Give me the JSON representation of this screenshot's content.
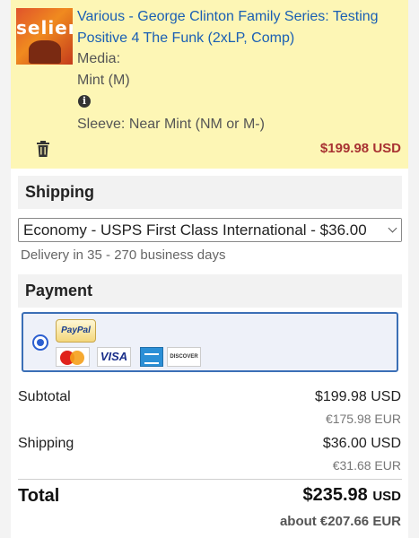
{
  "item": {
    "title": "Various - George Clinton Family Series: Testing Positive 4 The Funk (2xLP, Comp)",
    "media_label": "Media:",
    "media_value": "Mint (M)",
    "info_icon": "info-icon",
    "sleeve": "Sleeve: Near Mint (NM or M-)",
    "price": "$199.98",
    "price_currency": "USD",
    "thumb_text": "selier"
  },
  "shipping": {
    "heading": "Shipping",
    "selected_option": "Economy - USPS First Class International - $36.00",
    "delivery": "Delivery in 35 - 270 business days"
  },
  "payment": {
    "heading": "Payment",
    "methods": [
      "PayPal",
      "MasterCard",
      "VISA",
      "American Express",
      "DISCOVER"
    ],
    "paypal_label": "PayPal",
    "visa_label": "VISA",
    "discover_label": "DISCOVER"
  },
  "summary": {
    "subtotal_label": "Subtotal",
    "subtotal_usd": "$199.98 USD",
    "subtotal_eur": "€175.98 EUR",
    "shipping_label": "Shipping",
    "shipping_usd": "$36.00 USD",
    "shipping_eur": "€31.68 EUR",
    "total_label": "Total",
    "total_usd": "$235.98",
    "total_currency": "USD",
    "total_about": "about €207.66 EUR"
  },
  "colors": {
    "item_bg": "#fdf6b5",
    "link": "#1a5fb4",
    "price": "#a83232",
    "payment_border": "#3b6fb6"
  }
}
